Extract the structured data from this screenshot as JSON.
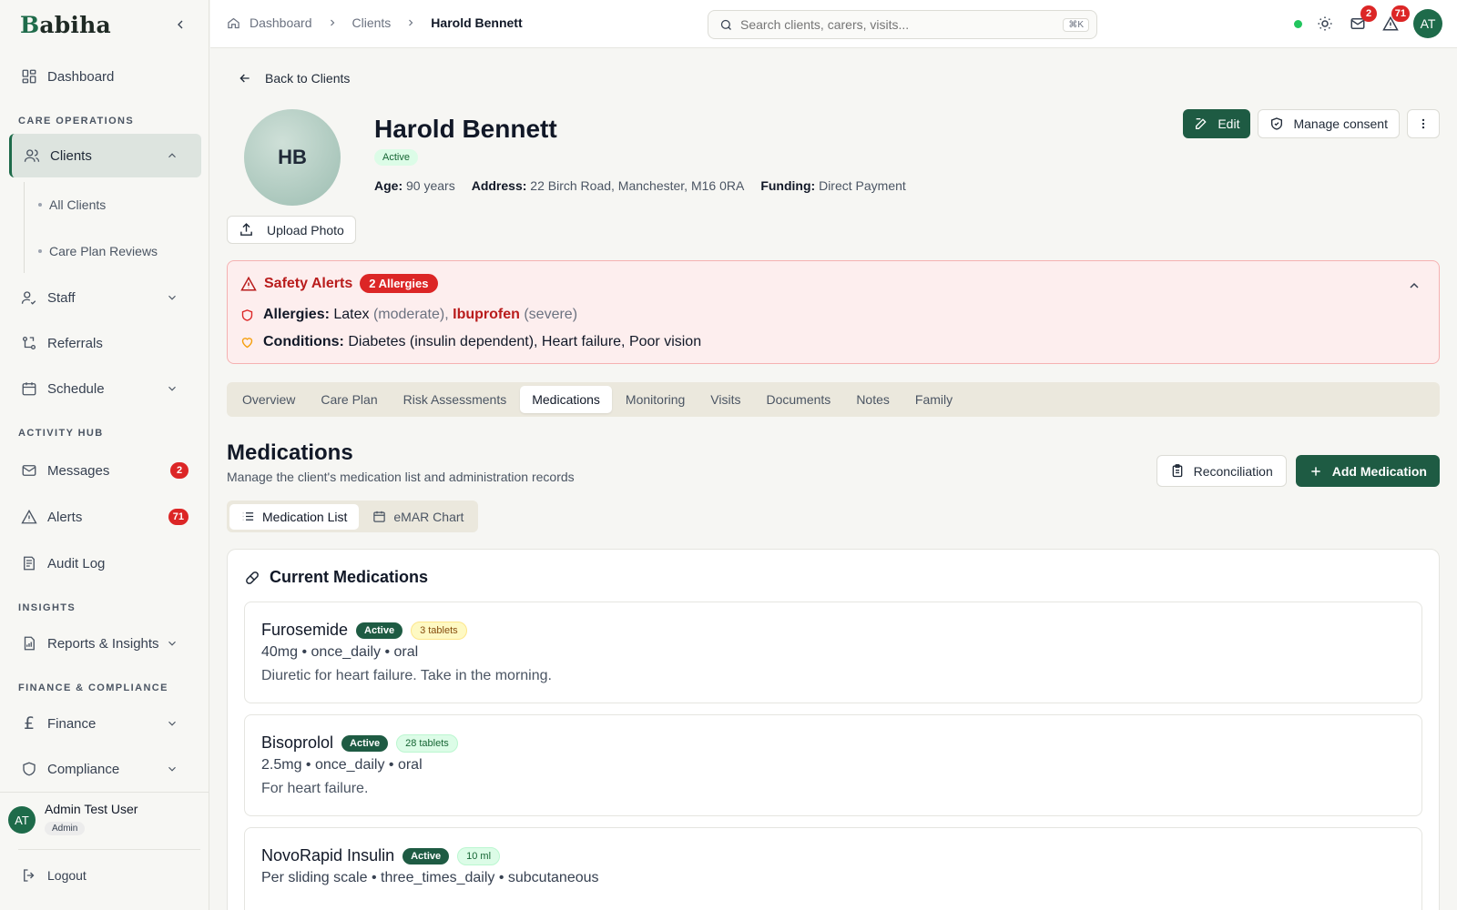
{
  "app": {
    "logo_first": "B",
    "logo_rest": "abiha"
  },
  "sidebar": {
    "dashboard": "Dashboard",
    "sections": {
      "care": "CARE OPERATIONS",
      "activity": "ACTIVITY HUB",
      "insights": "INSIGHTS",
      "finance": "FINANCE & COMPLIANCE"
    },
    "clients": "Clients",
    "sub": {
      "all": "All Clients",
      "reviews": "Care Plan Reviews"
    },
    "staff": "Staff",
    "referrals": "Referrals",
    "schedule": "Schedule",
    "messages": "Messages",
    "messages_count": "2",
    "alerts": "Alerts",
    "alerts_count": "71",
    "audit": "Audit Log",
    "reports": "Reports & Insights",
    "finance": "Finance",
    "compliance": "Compliance",
    "user": {
      "initials": "AT",
      "name": "Admin Test User",
      "role": "Admin"
    },
    "logout": "Logout"
  },
  "topbar": {
    "crumbs": [
      "Dashboard",
      "Clients",
      "Harold Bennett"
    ],
    "search_placeholder": "Search clients, carers, visits...",
    "shortcut": "⌘K",
    "mail_count": "2",
    "alert_count": "71",
    "avatar": "AT"
  },
  "client": {
    "back": "Back to Clients",
    "initials": "HB",
    "upload": "Upload Photo",
    "name": "Harold Bennett",
    "status": "Active",
    "age_label": "Age:",
    "age": "90 years",
    "address_label": "Address:",
    "address": "22 Birch Road, Manchester, M16 0RA",
    "funding_label": "Funding:",
    "funding": "Direct Payment",
    "edit": "Edit",
    "consent": "Manage consent"
  },
  "safety": {
    "title": "Safety Alerts",
    "badge": "2 Allergies",
    "allergies_label": "Allergies:",
    "allergy1": "Latex",
    "allergy1_sev": "(moderate),",
    "allergy2": "Ibuprofen",
    "allergy2_sev": "(severe)",
    "conditions_label": "Conditions:",
    "conditions": "Diabetes (insulin dependent), Heart failure, Poor vision"
  },
  "tabs": [
    "Overview",
    "Care Plan",
    "Risk Assessments",
    "Medications",
    "Monitoring",
    "Visits",
    "Documents",
    "Notes",
    "Family"
  ],
  "medications": {
    "title": "Medications",
    "subtitle": "Manage the client's medication list and administration records",
    "reconciliation": "Reconciliation",
    "add": "Add Medication",
    "view_list": "Medication List",
    "view_emar": "eMAR Chart",
    "panel_title": "Current Medications",
    "items": [
      {
        "name": "Furosemide",
        "status": "Active",
        "stock": "3 tablets",
        "dose": "40mg • once_daily • oral",
        "note": "Diuretic for heart failure. Take in the morning."
      },
      {
        "name": "Bisoprolol",
        "status": "Active",
        "stock": "28 tablets",
        "dose": "2.5mg • once_daily • oral",
        "note": "For heart failure."
      },
      {
        "name": "NovoRapid Insulin",
        "status": "Active",
        "stock": "10 ml",
        "dose": "Per sliding scale • three_times_daily • subcutaneous",
        "note": ""
      }
    ]
  },
  "colors": {
    "brand": "#1e5b43",
    "alert": "#dc2626"
  }
}
